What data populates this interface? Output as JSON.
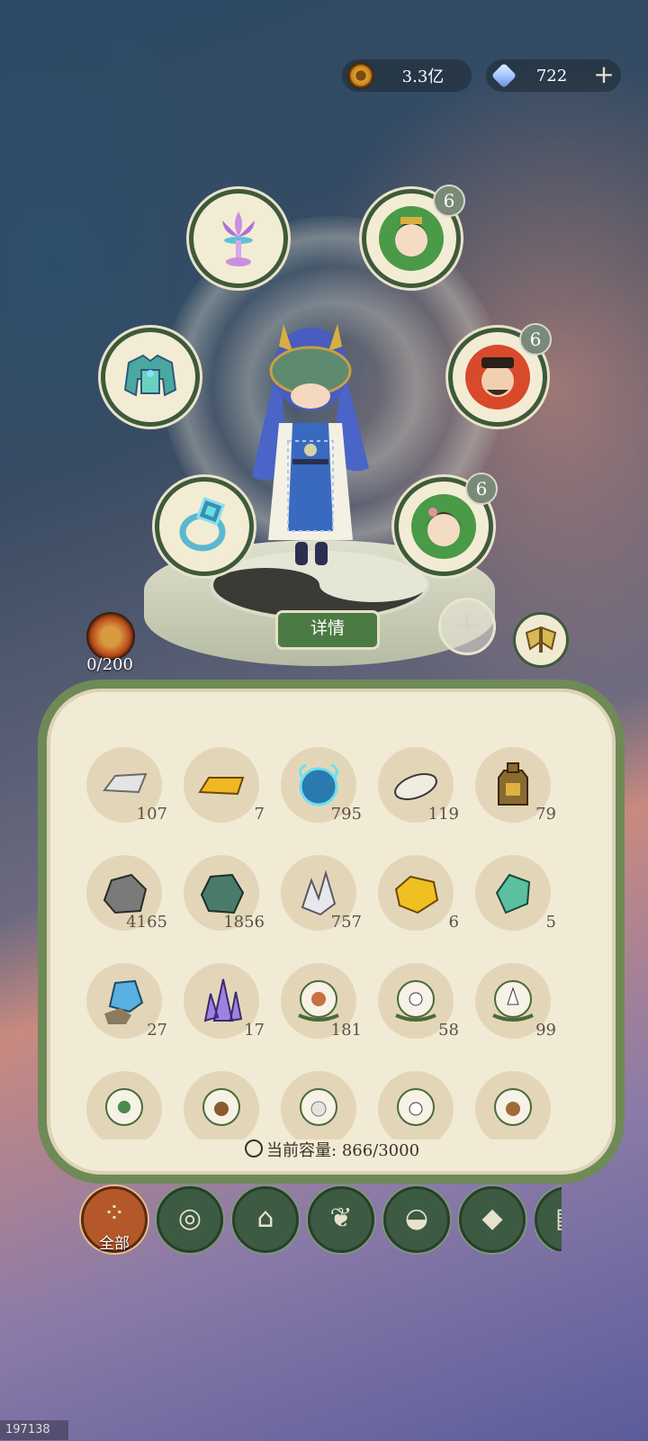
{
  "currency": {
    "coins": "3.3亿",
    "gems": "722",
    "add_label": "+"
  },
  "equipment_slots": [
    {
      "name": "lotus-lamp",
      "icon": "lotus-icon"
    },
    {
      "name": "armor",
      "icon": "armor-icon"
    },
    {
      "name": "ring",
      "icon": "ring-icon"
    }
  ],
  "companion_slots": [
    {
      "icon": "queen-portrait-icon",
      "level": "6"
    },
    {
      "icon": "official-portrait-icon",
      "level": "6"
    },
    {
      "icon": "lady-portrait-icon",
      "level": "6"
    }
  ],
  "detail_button": "详情",
  "add_slot_label": "+",
  "monster_count": "0/200",
  "inventory": {
    "items": [
      {
        "icon": "silver-ingot-icon",
        "count": "107"
      },
      {
        "icon": "gold-ingot-icon",
        "count": "7"
      },
      {
        "icon": "spirit-orb-icon",
        "count": "795"
      },
      {
        "icon": "white-stone-icon",
        "count": "119"
      },
      {
        "icon": "bronze-token-icon",
        "count": "79"
      },
      {
        "icon": "gray-ore-icon",
        "count": "4165"
      },
      {
        "icon": "green-ore-icon",
        "count": "1856"
      },
      {
        "icon": "quartz-crystal-icon",
        "count": "757"
      },
      {
        "icon": "gold-nugget-icon",
        "count": "6"
      },
      {
        "icon": "jade-shard-icon",
        "count": "5"
      },
      {
        "icon": "blue-crystal-icon",
        "count": "27"
      },
      {
        "icon": "purple-crystal-icon",
        "count": "17"
      },
      {
        "icon": "chicken-egg-icon",
        "count": "181"
      },
      {
        "icon": "white-bird-egg-icon",
        "count": "58"
      },
      {
        "icon": "goose-egg-icon",
        "count": "99"
      },
      {
        "icon": "duck-egg-icon",
        "count": ""
      },
      {
        "icon": "ox-egg-icon",
        "count": ""
      },
      {
        "icon": "sheep-egg-icon",
        "count": ""
      },
      {
        "icon": "goat-egg-icon",
        "count": ""
      },
      {
        "icon": "horse-egg-icon",
        "count": ""
      }
    ],
    "capacity_label": "当前容量:",
    "capacity_value": "866/3000"
  },
  "categories": [
    {
      "label": "全部",
      "icon": "grid-icon",
      "active": true
    },
    {
      "label": "",
      "icon": "log-icon",
      "active": false
    },
    {
      "label": "",
      "icon": "house-icon",
      "active": false
    },
    {
      "label": "",
      "icon": "herb-icon",
      "active": false
    },
    {
      "label": "",
      "icon": "rice-bowl-icon",
      "active": false
    },
    {
      "label": "",
      "icon": "ore-icon",
      "active": false
    },
    {
      "label": "",
      "icon": "scroll-icon",
      "active": false
    }
  ],
  "user_id": "197138",
  "colors": {
    "panel_border": "#6e8a56",
    "active_tab": "#b4582a",
    "tab": "#3d5a42",
    "detail_button": "#4c7a44"
  }
}
